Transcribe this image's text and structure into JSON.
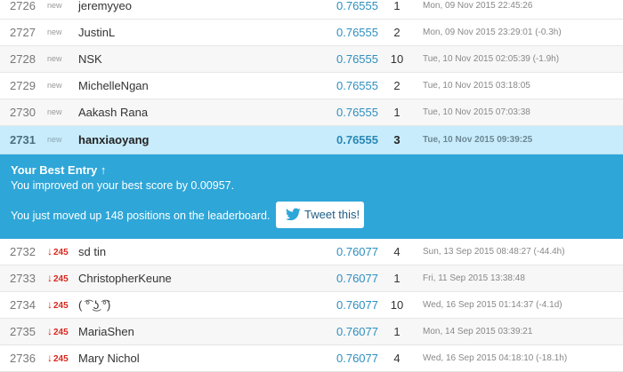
{
  "rows_top": [
    {
      "rank": "2726",
      "delta": "new",
      "team": "jeremyyeo",
      "score": "0.76555",
      "entries": "1",
      "last": "Mon, 09 Nov 2015 22:45:26"
    },
    {
      "rank": "2727",
      "delta": "new",
      "team": "JustinL",
      "score": "0.76555",
      "entries": "2",
      "last": "Mon, 09 Nov 2015 23:29:01 (-0.3h)"
    },
    {
      "rank": "2728",
      "delta": "new",
      "team": "NSK",
      "score": "0.76555",
      "entries": "10",
      "last": "Tue, 10 Nov 2015 02:05:39 (-1.9h)"
    },
    {
      "rank": "2729",
      "delta": "new",
      "team": "MichelleNgan",
      "score": "0.76555",
      "entries": "2",
      "last": "Tue, 10 Nov 2015 03:18:05"
    },
    {
      "rank": "2730",
      "delta": "new",
      "team": "Aakash Rana",
      "score": "0.76555",
      "entries": "1",
      "last": "Tue, 10 Nov 2015 07:03:38"
    }
  ],
  "highlight_row": {
    "rank": "2731",
    "delta": "new",
    "team": "hanxiaoyang",
    "score": "0.76555",
    "entries": "3",
    "last": "Tue, 10 Nov 2015 09:39:25"
  },
  "best_entry": {
    "title": "Your Best Entry ↑",
    "improved_text": "You improved on your best score by 0.00957.",
    "moved_text": "You just moved up 148 positions on the leaderboard.",
    "tweet_label": "Tweet this!"
  },
  "rows_bottom": [
    {
      "rank": "2732",
      "arrow": "↓",
      "delta": "245",
      "team": "sd tin",
      "score": "0.76077",
      "entries": "4",
      "last": "Sun, 13 Sep 2015 08:48:27 (-44.4h)"
    },
    {
      "rank": "2733",
      "arrow": "↓",
      "delta": "245",
      "team": "ChristopherKeune",
      "score": "0.76077",
      "entries": "1",
      "last": "Fri, 11 Sep 2015 13:38:48"
    },
    {
      "rank": "2734",
      "arrow": "↓",
      "delta": "245",
      "team": "( ͡° ͜ʖ ͡°)",
      "score": "0.76077",
      "entries": "10",
      "last": "Wed, 16 Sep 2015 01:14:37 (-4.1d)"
    },
    {
      "rank": "2735",
      "arrow": "↓",
      "delta": "245",
      "team": "MariaShen",
      "score": "0.76077",
      "entries": "1",
      "last": "Mon, 14 Sep 2015 03:39:21"
    },
    {
      "rank": "2736",
      "arrow": "↓",
      "delta": "245",
      "team": "Mary Nichol",
      "score": "0.76077",
      "entries": "4",
      "last": "Wed, 16 Sep 2015 04:18:10 (-18.1h)"
    }
  ],
  "colors": {
    "highlight_bg": "#c8ecfb",
    "banner_bg": "#2ea6d8",
    "score_blue": "#2e8fc0",
    "drop_red": "#d8261c"
  },
  "icons": {
    "tweet": "twitter-bird-icon"
  }
}
